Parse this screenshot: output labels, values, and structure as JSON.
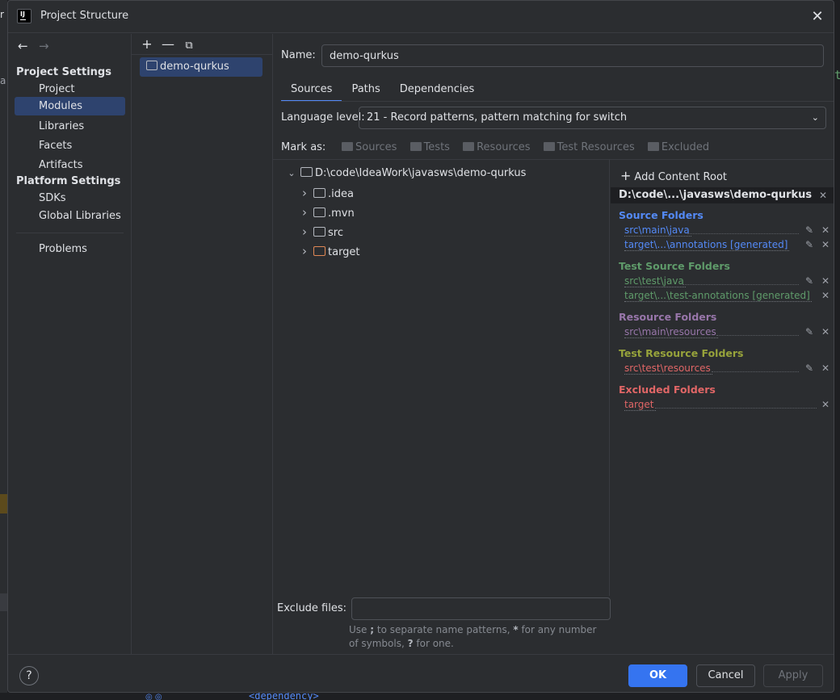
{
  "window": {
    "title": "Project Structure"
  },
  "background": {
    "left_char": "r",
    "left_char2": "a",
    "right_char": "ta",
    "bottom_code": "<dependency>"
  },
  "nav": {
    "project_settings": "Project Settings",
    "items_project": [
      "Project",
      "Modules",
      "Libraries",
      "Facets",
      "Artifacts"
    ],
    "platform_settings": "Platform Settings",
    "items_platform": [
      "SDKs",
      "Global Libraries"
    ],
    "problems": "Problems",
    "selected": "Modules"
  },
  "modules": {
    "toolbar": [
      "+",
      "—",
      "⧉"
    ],
    "items": [
      "demo-qurkus"
    ]
  },
  "main": {
    "name_label": "Name:",
    "name_value": "demo-qurkus",
    "tabs": [
      "Sources",
      "Paths",
      "Dependencies"
    ],
    "active_tab": "Sources",
    "language_label": "Language level:",
    "language_value": "21 - Record patterns, pattern matching for switch",
    "mark_label": "Mark as:",
    "mark_items": [
      "Sources",
      "Tests",
      "Resources",
      "Test Resources",
      "Excluded"
    ]
  },
  "tree": {
    "root": "D:\\code\\IdeaWork\\javasws\\demo-qurkus",
    "children": [
      ".idea",
      ".mvn",
      "src",
      "target"
    ]
  },
  "content_root": {
    "add_label": "Add Content Root",
    "root_path": "D:\\code\\...\\javasws\\demo-qurkus",
    "groups": [
      {
        "title": "Source Folders",
        "paths": [
          "src\\main\\java",
          "target\\...\\annotations [generated]"
        ]
      },
      {
        "title": "Test Source Folders",
        "paths": [
          "src\\test\\java",
          "target\\...\\test-annotations [generated]"
        ]
      },
      {
        "title": "Resource Folders",
        "paths": [
          "src\\main\\resources"
        ]
      },
      {
        "title": "Test Resource Folders",
        "paths": [
          "src\\test\\resources"
        ]
      },
      {
        "title": "Excluded Folders",
        "paths": [
          "target"
        ]
      }
    ]
  },
  "exclude": {
    "label": "Exclude files:",
    "value": "",
    "hint_1": "Use ",
    "hint_semicolon": ";",
    "hint_2": " to separate name patterns, ",
    "hint_star": "*",
    "hint_3": " for any number of symbols, ",
    "hint_q": "?",
    "hint_4": " for one."
  },
  "footer": {
    "help": "?",
    "ok": "OK",
    "cancel": "Cancel",
    "apply": "Apply"
  },
  "icons": {
    "close": "✕",
    "back": "←",
    "forward": "→",
    "chev_down": "⌄",
    "chev_right": "›",
    "edit": "✎",
    "remove": "✕"
  }
}
